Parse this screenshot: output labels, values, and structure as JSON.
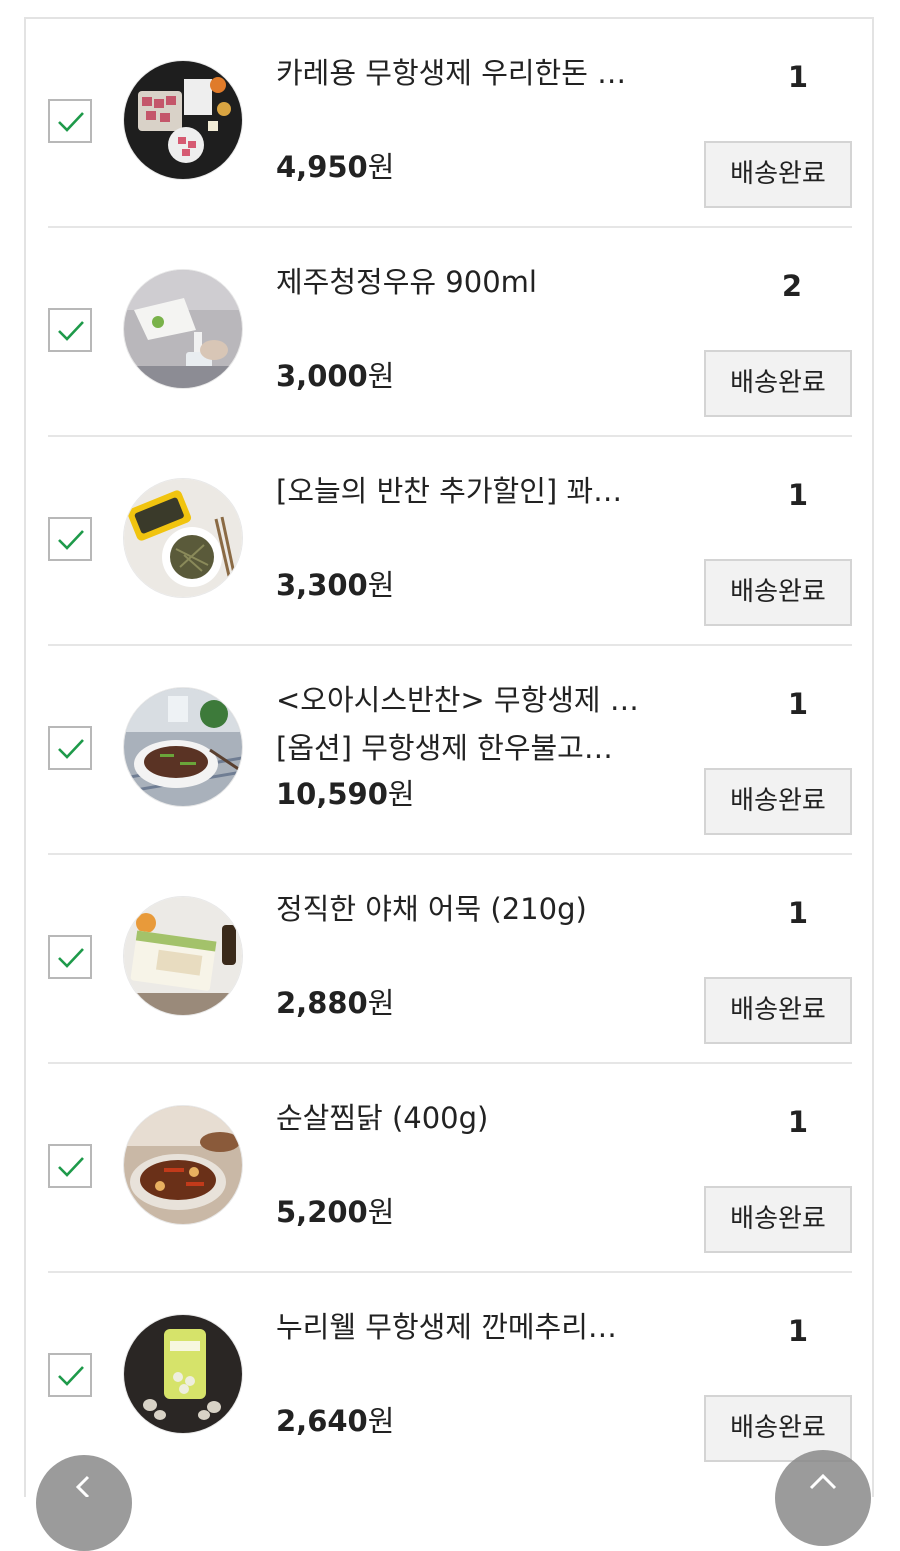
{
  "items": [
    {
      "name": "카레용 무항생제 우리한돈 …",
      "option": "",
      "price": "4,950",
      "currency": "원",
      "quantity": "1",
      "status": "배송완료",
      "image": "diced-pork-dish"
    },
    {
      "name": "제주청정우유 900ml",
      "option": "",
      "price": "3,000",
      "currency": "원",
      "quantity": "2",
      "status": "배송완료",
      "image": "milk-pouring"
    },
    {
      "name": "[오늘의 반찬 추가할인] 꽈…",
      "option": "",
      "price": "3,300",
      "currency": "원",
      "quantity": "1",
      "status": "배송완료",
      "image": "side-dish-box"
    },
    {
      "name": "<오아시스반찬> 무항생제 …",
      "option": "[옵션] 무항생제 한우불고…",
      "price": "10,590",
      "currency": "원",
      "quantity": "1",
      "status": "배송완료",
      "image": "bulgogi-plate"
    },
    {
      "name": "정직한 야채 어묵 (210g)",
      "option": "",
      "price": "2,880",
      "currency": "원",
      "quantity": "1",
      "status": "배송완료",
      "image": "fish-cake-pack"
    },
    {
      "name": "순살찜닭 (400g)",
      "option": "",
      "price": "5,200",
      "currency": "원",
      "quantity": "1",
      "status": "배송완료",
      "image": "braised-chicken"
    },
    {
      "name": "누리웰 무항생제 깐메추리…",
      "option": "",
      "price": "2,640",
      "currency": "원",
      "quantity": "1",
      "status": "배송완료",
      "image": "quail-eggs-pouch"
    }
  ],
  "controls": {
    "back_icon": "chevron-left-icon",
    "top_icon": "chevron-up-icon"
  },
  "colors": {
    "check": "#1e9a4a",
    "accent": "#1e9a4a",
    "button_bg": "#f2f2f2",
    "divider": "#e6e6e6"
  }
}
